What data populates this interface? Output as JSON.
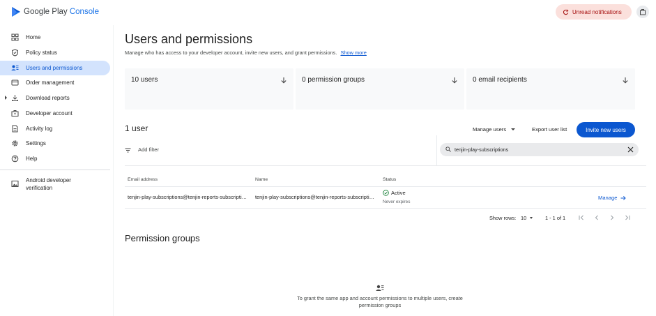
{
  "header": {
    "logo_prefix": "Google Play",
    "logo_suffix": "Console",
    "notifications_label": "Unread notifications",
    "brand_color": "#1a73e8"
  },
  "sidebar": {
    "items": [
      {
        "label": "Home",
        "icon": "grid-icon"
      },
      {
        "label": "Policy status",
        "icon": "shield-icon"
      },
      {
        "label": "Users and permissions",
        "icon": "users-icon",
        "active": true
      },
      {
        "label": "Order management",
        "icon": "card-icon"
      },
      {
        "label": "Download reports",
        "icon": "download-icon"
      },
      {
        "label": "Developer account",
        "icon": "briefcase-icon"
      },
      {
        "label": "Activity log",
        "icon": "document-icon"
      },
      {
        "label": "Settings",
        "icon": "gear-icon"
      },
      {
        "label": "Help",
        "icon": "help-icon"
      }
    ],
    "extra_item": {
      "label": "Android developer verification",
      "icon": "image-icon"
    }
  },
  "main": {
    "title": "Users and permissions",
    "subtitle": "Manage who has access to your developer account, invite new users, and grant permissions.",
    "show_more": "Show more",
    "cards": [
      {
        "label": "10 users"
      },
      {
        "label": "0 permission groups"
      },
      {
        "label": "0 email recipients"
      }
    ],
    "users_count": "1 user",
    "manage_users": "Manage users",
    "export_list": "Export user list",
    "invite_button": "Invite new users",
    "add_filter": "Add filter",
    "search_value": "tenjin-play-subscriptions",
    "table": {
      "headers": [
        "Email address",
        "Name",
        "Status"
      ],
      "rows": [
        {
          "email": "tenjin-play-subscriptions@tenjin-reports-subscriptions.iam.gserviceaccount.com",
          "name": "tenjin-play-subscriptions@tenjin-reports-subscriptions.iam.gserviceaccount.com",
          "status": "Active",
          "status_sub": "Never expires",
          "action": "Manage"
        }
      ]
    },
    "pager": {
      "rows_label": "Show rows:",
      "rows_value": "10",
      "range": "1 - 1 of 1"
    },
    "permission_groups_title": "Permission groups",
    "permission_groups_empty": "To grant the same app and account permissions to multiple users, create permission groups"
  }
}
